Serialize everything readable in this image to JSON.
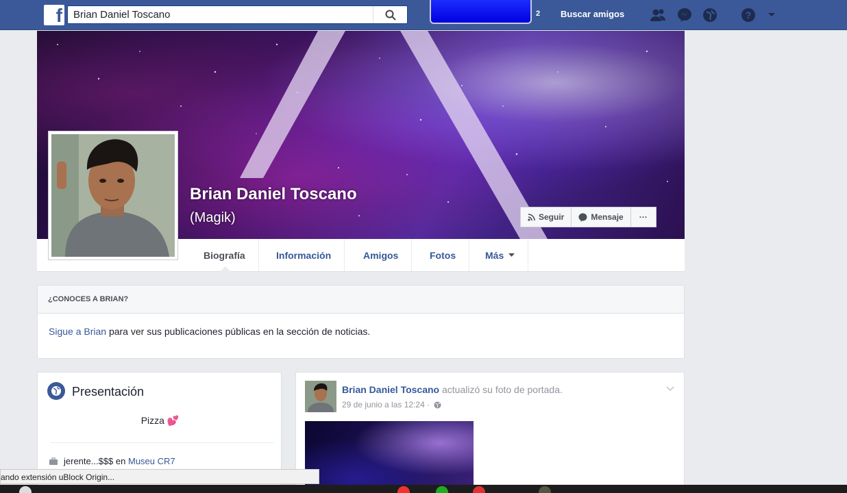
{
  "topbar": {
    "search_value": "Brian Daniel Toscano",
    "notification_count": "2",
    "find_friends": "Buscar amigos",
    "colors": {
      "bar": "#3b5998"
    }
  },
  "profile": {
    "name": "Brian Daniel Toscano",
    "nickname": "(Magik)",
    "actions": {
      "follow": "Seguir",
      "message": "Mensaje",
      "more": "···"
    }
  },
  "tabs": [
    {
      "label": "Biografía"
    },
    {
      "label": "Información"
    },
    {
      "label": "Amigos"
    },
    {
      "label": "Fotos"
    },
    {
      "label": "Más"
    }
  ],
  "know_card": {
    "header": "¿CONOCES A BRIAN?",
    "link": "Sigue a Brian",
    "text": " para ver sus publicaciones públicas en la sección de noticias."
  },
  "intro": {
    "title": "Presentación",
    "bio": "Pizza 💕",
    "work_text": "jerente...$$$ en",
    "work_place": "Museu CR7"
  },
  "post": {
    "author": "Brian Daniel Toscano",
    "action": " actualizó su foto de portada.",
    "date": "29 de junio a las 12:24 ·"
  },
  "status_bar": {
    "text": "ando extensión uBlock Origin..."
  }
}
